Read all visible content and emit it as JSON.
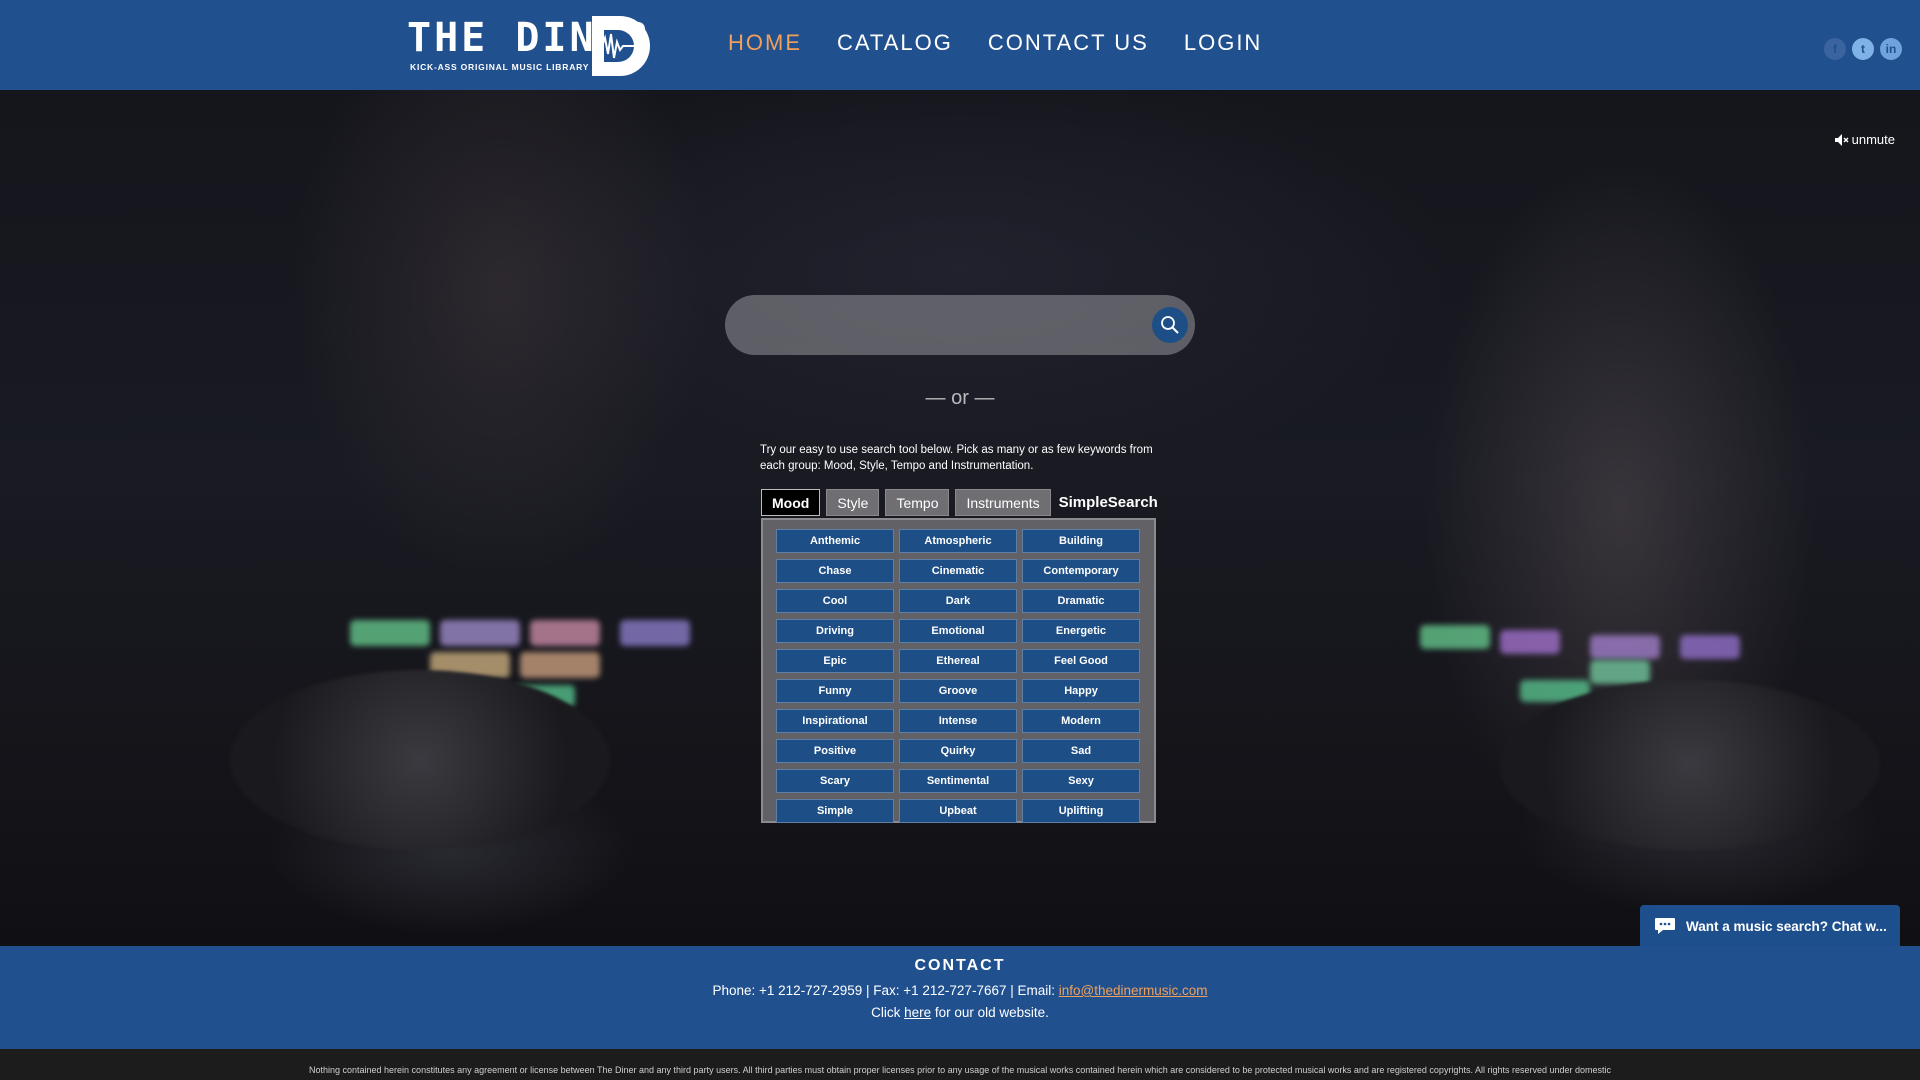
{
  "header": {
    "logo": {
      "title": "THE DINER",
      "tagline": "KICK-ASS ORIGINAL MUSIC LIBRARY",
      "letter": "D"
    },
    "nav": [
      {
        "label": "HOME",
        "active": true
      },
      {
        "label": "CATALOG",
        "active": false
      },
      {
        "label": "CONTACT US",
        "active": false
      },
      {
        "label": "LOGIN",
        "active": false
      }
    ],
    "social": {
      "facebook": "f",
      "twitter": "t",
      "linkedin": "in"
    }
  },
  "hero": {
    "unmute_label": "unmute",
    "search": {
      "placeholder": "",
      "value": ""
    },
    "or_text": "— or —",
    "intro_text": "Try our easy to use search tool below. Pick as many or as few keywords from each group: Mood, Style, Tempo and Instrumentation.",
    "tabs": [
      "Mood",
      "Style",
      "Tempo",
      "Instruments"
    ],
    "active_tab": "Mood",
    "simple_search_label": "SimpleSearch",
    "keywords": [
      "Anthemic",
      "Atmospheric",
      "Building",
      "Chase",
      "Cinematic",
      "Contemporary",
      "Cool",
      "Dark",
      "Dramatic",
      "Driving",
      "Emotional",
      "Energetic",
      "Epic",
      "Ethereal",
      "Feel Good",
      "Funny",
      "Groove",
      "Happy",
      "Inspirational",
      "Intense",
      "Modern",
      "Positive",
      "Quirky",
      "Sad",
      "Scary",
      "Sentimental",
      "Sexy",
      "Simple",
      "Upbeat",
      "Uplifting"
    ]
  },
  "chat": {
    "label": "Want a music search? Chat w..."
  },
  "contact": {
    "title": "CONTACT",
    "phone_fax": "Phone: +1 212-727-2959 | Fax: +1 212-727-7667 | Email: ",
    "email": "info@thedinermusic.com",
    "click": "Click ",
    "here": "here",
    "old_site": " for our old website."
  },
  "legal": {
    "text": "Nothing contained herein constitutes any agreement or license between The Diner and any third party users. All third parties must obtain proper licenses prior to any usage of the musical works contained herein which are considered to be protected musical works and are registered copyrights. All rights reserved under domestic"
  },
  "colors": {
    "brand_blue": "#21508f",
    "button_blue": "#1d4f86",
    "accent_orange": "#f0a05a"
  },
  "icons": {
    "search": "search-icon",
    "mute": "speaker-mute-icon",
    "chat": "chat-bubble-icon"
  }
}
